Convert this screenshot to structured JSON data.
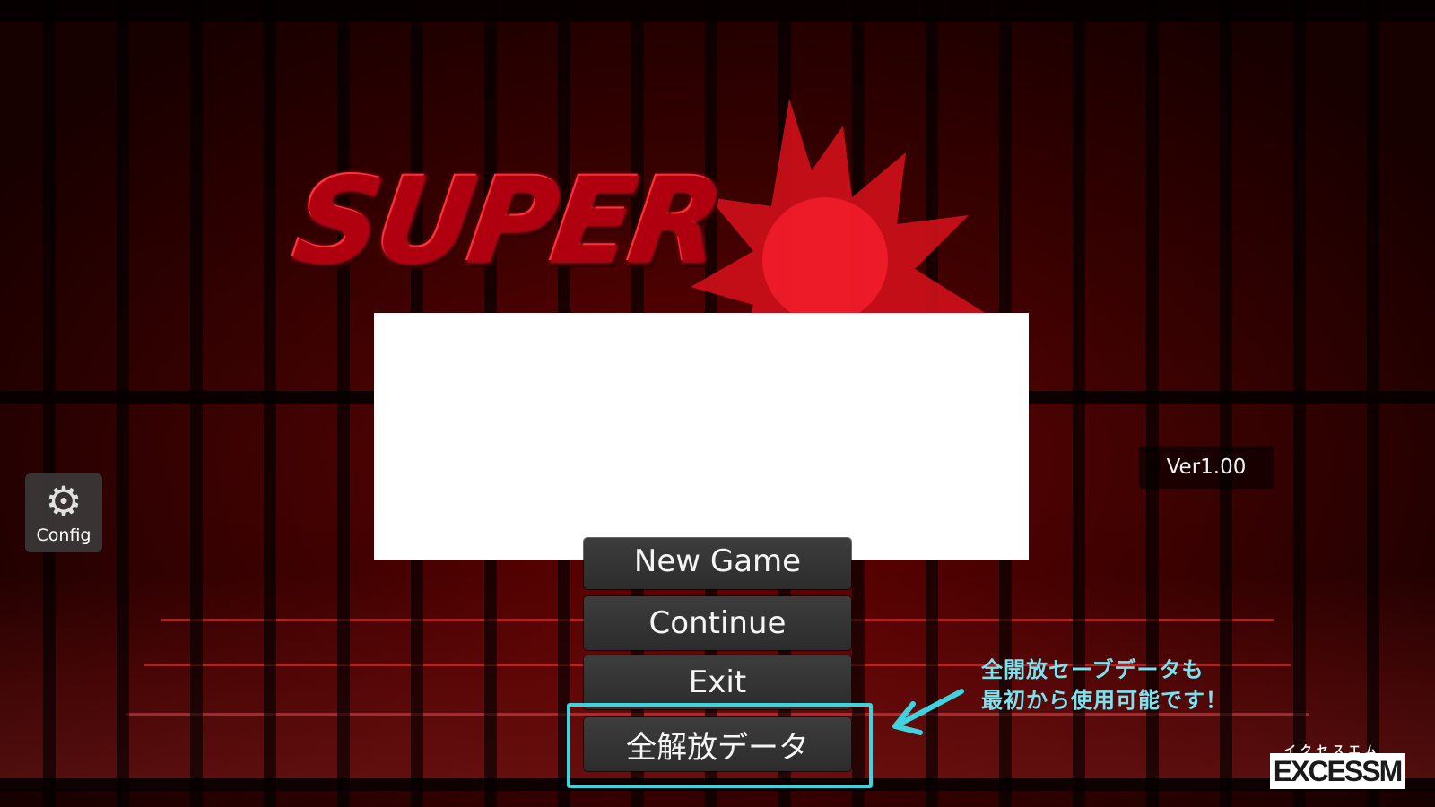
{
  "title_logo": {
    "line1": "SUPER"
  },
  "config": {
    "label": "Config",
    "icon": "gear-icon"
  },
  "version": "Ver1.00",
  "menu": {
    "new_game": "New Game",
    "continue": "Continue",
    "exit": "Exit",
    "unlock_all": "全解放データ"
  },
  "annotation": {
    "line1": "全開放セーブデータも",
    "line2": "最初から使用可能です！",
    "color": "#3fd3e0"
  },
  "brand": {
    "kana": "イクセスエム",
    "name": "EXCESSM"
  }
}
